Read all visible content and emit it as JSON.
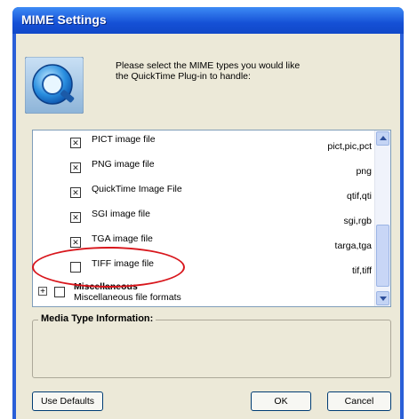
{
  "window": {
    "title": "MIME Settings"
  },
  "intro": {
    "text": "Please select the MIME types you would like the QuickTime Plug-in to handle:"
  },
  "mime_list": {
    "items": [
      {
        "label": "PICT image file",
        "extensions": "pict,pic,pct",
        "checked": true
      },
      {
        "label": "PNG image file",
        "extensions": "png",
        "checked": true
      },
      {
        "label": "QuickTime Image File",
        "extensions": "qtif,qti",
        "checked": true
      },
      {
        "label": "SGI image file",
        "extensions": "sgi,rgb",
        "checked": true
      },
      {
        "label": "TGA image file",
        "extensions": "targa,tga",
        "checked": true
      },
      {
        "label": "TIFF image file",
        "extensions": "tif,tiff",
        "checked": false
      }
    ],
    "group": {
      "expander": "+",
      "label": "Miscellaneous",
      "sublabel": "Miscellaneous file formats",
      "checked": false
    }
  },
  "info_panel": {
    "title": "Media Type Information:"
  },
  "buttons": {
    "use_defaults": "Use Defaults",
    "ok": "OK",
    "cancel": "Cancel"
  },
  "colors": {
    "annotation": "#d8161c",
    "title_bar": "#1550d6",
    "dialog_bg": "#ece9d8"
  },
  "icons": {
    "logo": "quicktime-logo"
  }
}
